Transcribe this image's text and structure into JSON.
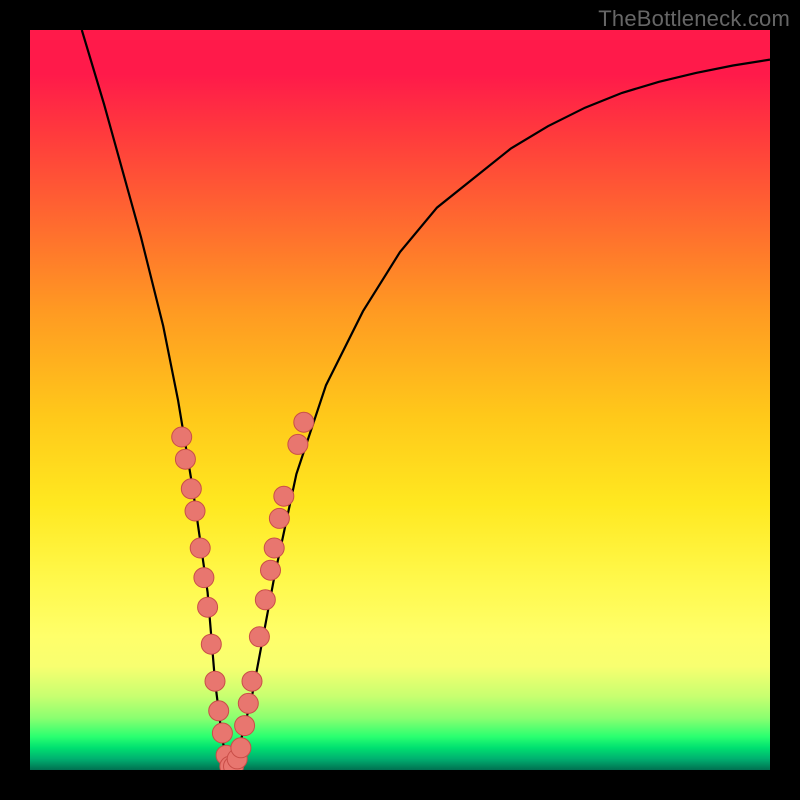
{
  "watermark": "TheBottleneck.com",
  "chart_data": {
    "type": "line",
    "title": "",
    "xlabel": "",
    "ylabel": "",
    "xlim": [
      0,
      100
    ],
    "ylim": [
      0,
      100
    ],
    "grid": false,
    "legend": false,
    "series": [
      {
        "name": "bottleneck-curve",
        "x": [
          7,
          10,
          15,
          18,
          20,
          22,
          24,
          25,
          26,
          27,
          28,
          30,
          33,
          36,
          40,
          45,
          50,
          55,
          60,
          65,
          70,
          75,
          80,
          85,
          90,
          95,
          100
        ],
        "y": [
          100,
          90,
          72,
          60,
          50,
          38,
          24,
          12,
          4,
          0,
          2,
          10,
          26,
          40,
          52,
          62,
          70,
          76,
          80,
          84,
          87,
          89.5,
          91.5,
          93,
          94.2,
          95.2,
          96
        ]
      }
    ],
    "points": [
      {
        "name": "cluster-left-a",
        "x": 20.5,
        "y": 45
      },
      {
        "name": "cluster-left-b",
        "x": 21.0,
        "y": 42
      },
      {
        "name": "cluster-left-c",
        "x": 21.8,
        "y": 38
      },
      {
        "name": "cluster-left-d",
        "x": 22.3,
        "y": 35
      },
      {
        "name": "cluster-left-e",
        "x": 23.0,
        "y": 30
      },
      {
        "name": "cluster-left-f",
        "x": 23.5,
        "y": 26
      },
      {
        "name": "cluster-left-g",
        "x": 24.0,
        "y": 22
      },
      {
        "name": "cluster-left-h",
        "x": 24.5,
        "y": 17
      },
      {
        "name": "cluster-left-i",
        "x": 25.0,
        "y": 12
      },
      {
        "name": "cluster-left-j",
        "x": 25.5,
        "y": 8
      },
      {
        "name": "cluster-left-k",
        "x": 26.0,
        "y": 5
      },
      {
        "name": "cluster-bottom-a",
        "x": 26.5,
        "y": 2
      },
      {
        "name": "cluster-bottom-b",
        "x": 27.0,
        "y": 0.5
      },
      {
        "name": "cluster-bottom-c",
        "x": 27.5,
        "y": 0.5
      },
      {
        "name": "cluster-bottom-d",
        "x": 28.0,
        "y": 1.5
      },
      {
        "name": "cluster-bottom-e",
        "x": 28.5,
        "y": 3
      },
      {
        "name": "cluster-right-a",
        "x": 29.0,
        "y": 6
      },
      {
        "name": "cluster-right-b",
        "x": 29.5,
        "y": 9
      },
      {
        "name": "cluster-right-c",
        "x": 30.0,
        "y": 12
      },
      {
        "name": "cluster-right-d",
        "x": 31.0,
        "y": 18
      },
      {
        "name": "cluster-right-e",
        "x": 31.8,
        "y": 23
      },
      {
        "name": "cluster-right-f",
        "x": 32.5,
        "y": 27
      },
      {
        "name": "cluster-right-g",
        "x": 33.0,
        "y": 30
      },
      {
        "name": "cluster-right-h",
        "x": 33.7,
        "y": 34
      },
      {
        "name": "cluster-right-i",
        "x": 34.3,
        "y": 37
      },
      {
        "name": "cluster-right-j",
        "x": 36.2,
        "y": 44
      },
      {
        "name": "cluster-right-k",
        "x": 37.0,
        "y": 47
      }
    ],
    "colors": {
      "curve": "#000000",
      "points_fill": "#e8766f",
      "points_stroke": "#c94e48",
      "gradient_top": "#ff1a4a",
      "gradient_bottom": "#007050"
    }
  }
}
